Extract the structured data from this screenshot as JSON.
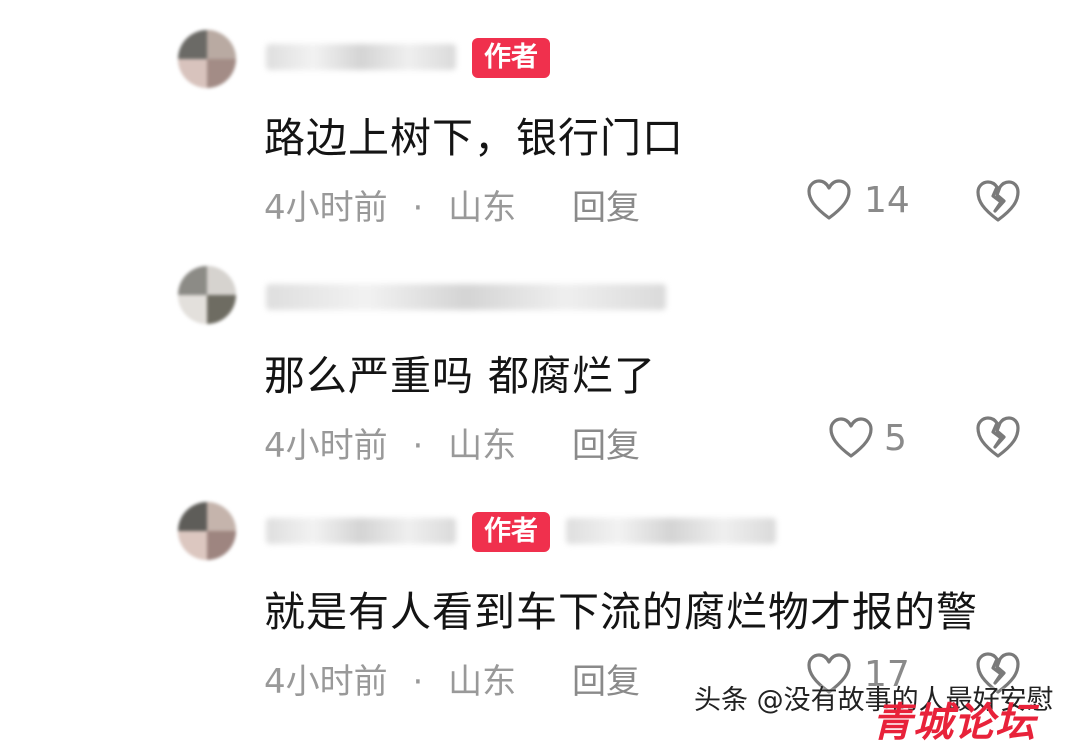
{
  "comments": [
    {
      "author_tag": "作者",
      "text": "路边上树下，银行门口",
      "time": "4小时前",
      "sep": "·",
      "location": "山东",
      "reply_label": "回复",
      "likes": "14"
    },
    {
      "author_tag": "",
      "text": "那么严重吗   都腐烂了",
      "time": "4小时前",
      "sep": "·",
      "location": "山东",
      "reply_label": "回复",
      "likes": "5"
    },
    {
      "author_tag": "作者",
      "text": "就是有人看到车下流的腐烂物才报的警",
      "time": "4小时前",
      "sep": "·",
      "location": "山东",
      "reply_label": "回复",
      "likes": "17"
    }
  ],
  "icons": {
    "like": "heart-outline-icon",
    "dislike": "broken-heart-icon"
  },
  "colors": {
    "author_tag_bg": "#f0304d",
    "meta_text": "#999999"
  },
  "watermark": {
    "text": "头条 @没有故事的人最好安慰",
    "site": "青城论坛"
  }
}
